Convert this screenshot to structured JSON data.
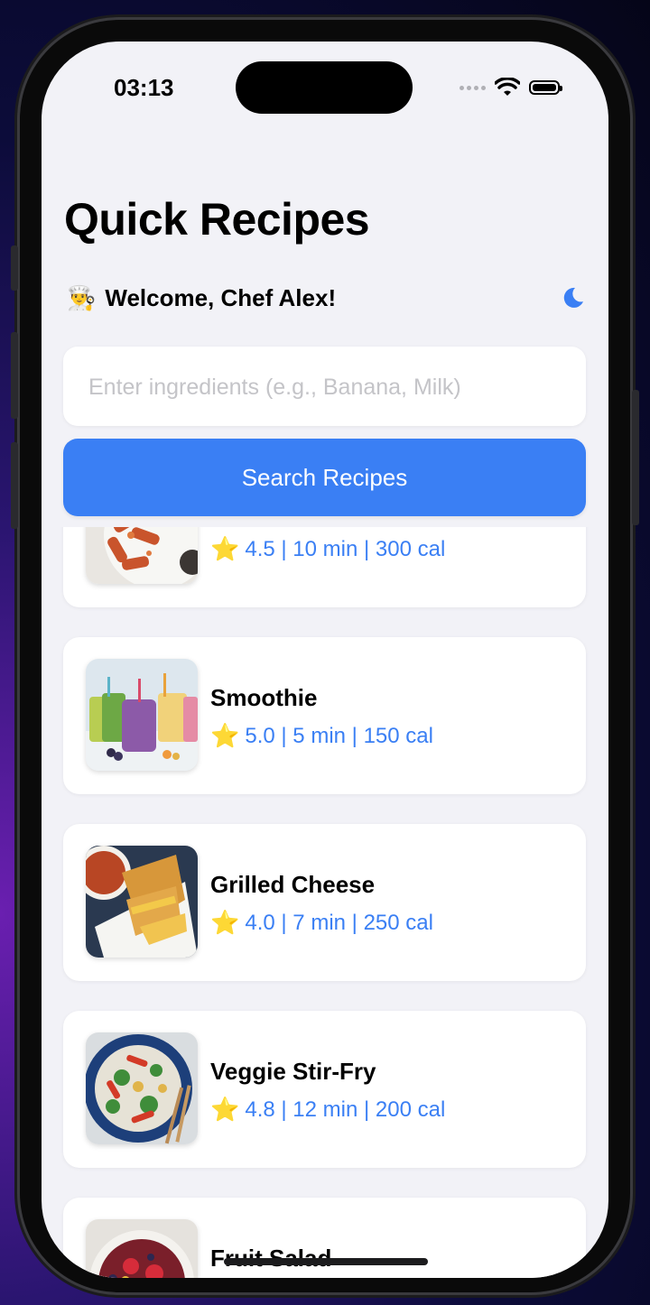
{
  "status_bar": {
    "time": "03:13"
  },
  "header": {
    "title": "Quick Recipes"
  },
  "welcome": {
    "emoji": "👨‍🍳",
    "text": "Welcome, Chef Alex!",
    "theme_icon": "moon-icon"
  },
  "search": {
    "placeholder": "Enter ingredients (e.g., Banana, Milk)",
    "value": "",
    "button_label": "Search Recipes"
  },
  "recipes": [
    {
      "name": "",
      "rating_icon": "⭐",
      "meta": "4.5 | 10 min | 300 cal",
      "image": "pasta"
    },
    {
      "name": "Smoothie",
      "rating_icon": "⭐",
      "meta": "5.0 | 5 min | 150 cal",
      "image": "smoothie"
    },
    {
      "name": "Grilled Cheese",
      "rating_icon": "⭐",
      "meta": "4.0 | 7 min | 250 cal",
      "image": "grilled-cheese"
    },
    {
      "name": "Veggie Stir-Fry",
      "rating_icon": "⭐",
      "meta": "4.8 | 12 min | 200 cal",
      "image": "stir-fry"
    },
    {
      "name": "Fruit Salad",
      "rating_icon": "",
      "meta": "",
      "image": "fruit-salad"
    }
  ],
  "colors": {
    "accent": "#3a7ff4",
    "background": "#f2f2f7",
    "card": "#ffffff"
  }
}
